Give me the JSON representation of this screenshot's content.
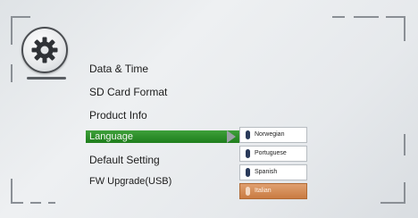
{
  "settings_menu": {
    "icon": "gear-icon",
    "items": [
      {
        "label": "Data & Time"
      },
      {
        "label": "SD Card Format"
      },
      {
        "label": "Product Info"
      },
      {
        "label": "Language",
        "selected": true
      },
      {
        "label": "Default Setting"
      },
      {
        "label": "FW Upgrade(USB)"
      }
    ]
  },
  "language_submenu": {
    "options": [
      {
        "label": "Norwegian"
      },
      {
        "label": "Portuguese"
      },
      {
        "label": "Spanish"
      },
      {
        "label": "Italian",
        "active": true
      }
    ]
  },
  "colors": {
    "selected_bg": "#2e8f2b",
    "active_option_bg": "#c97b42"
  }
}
